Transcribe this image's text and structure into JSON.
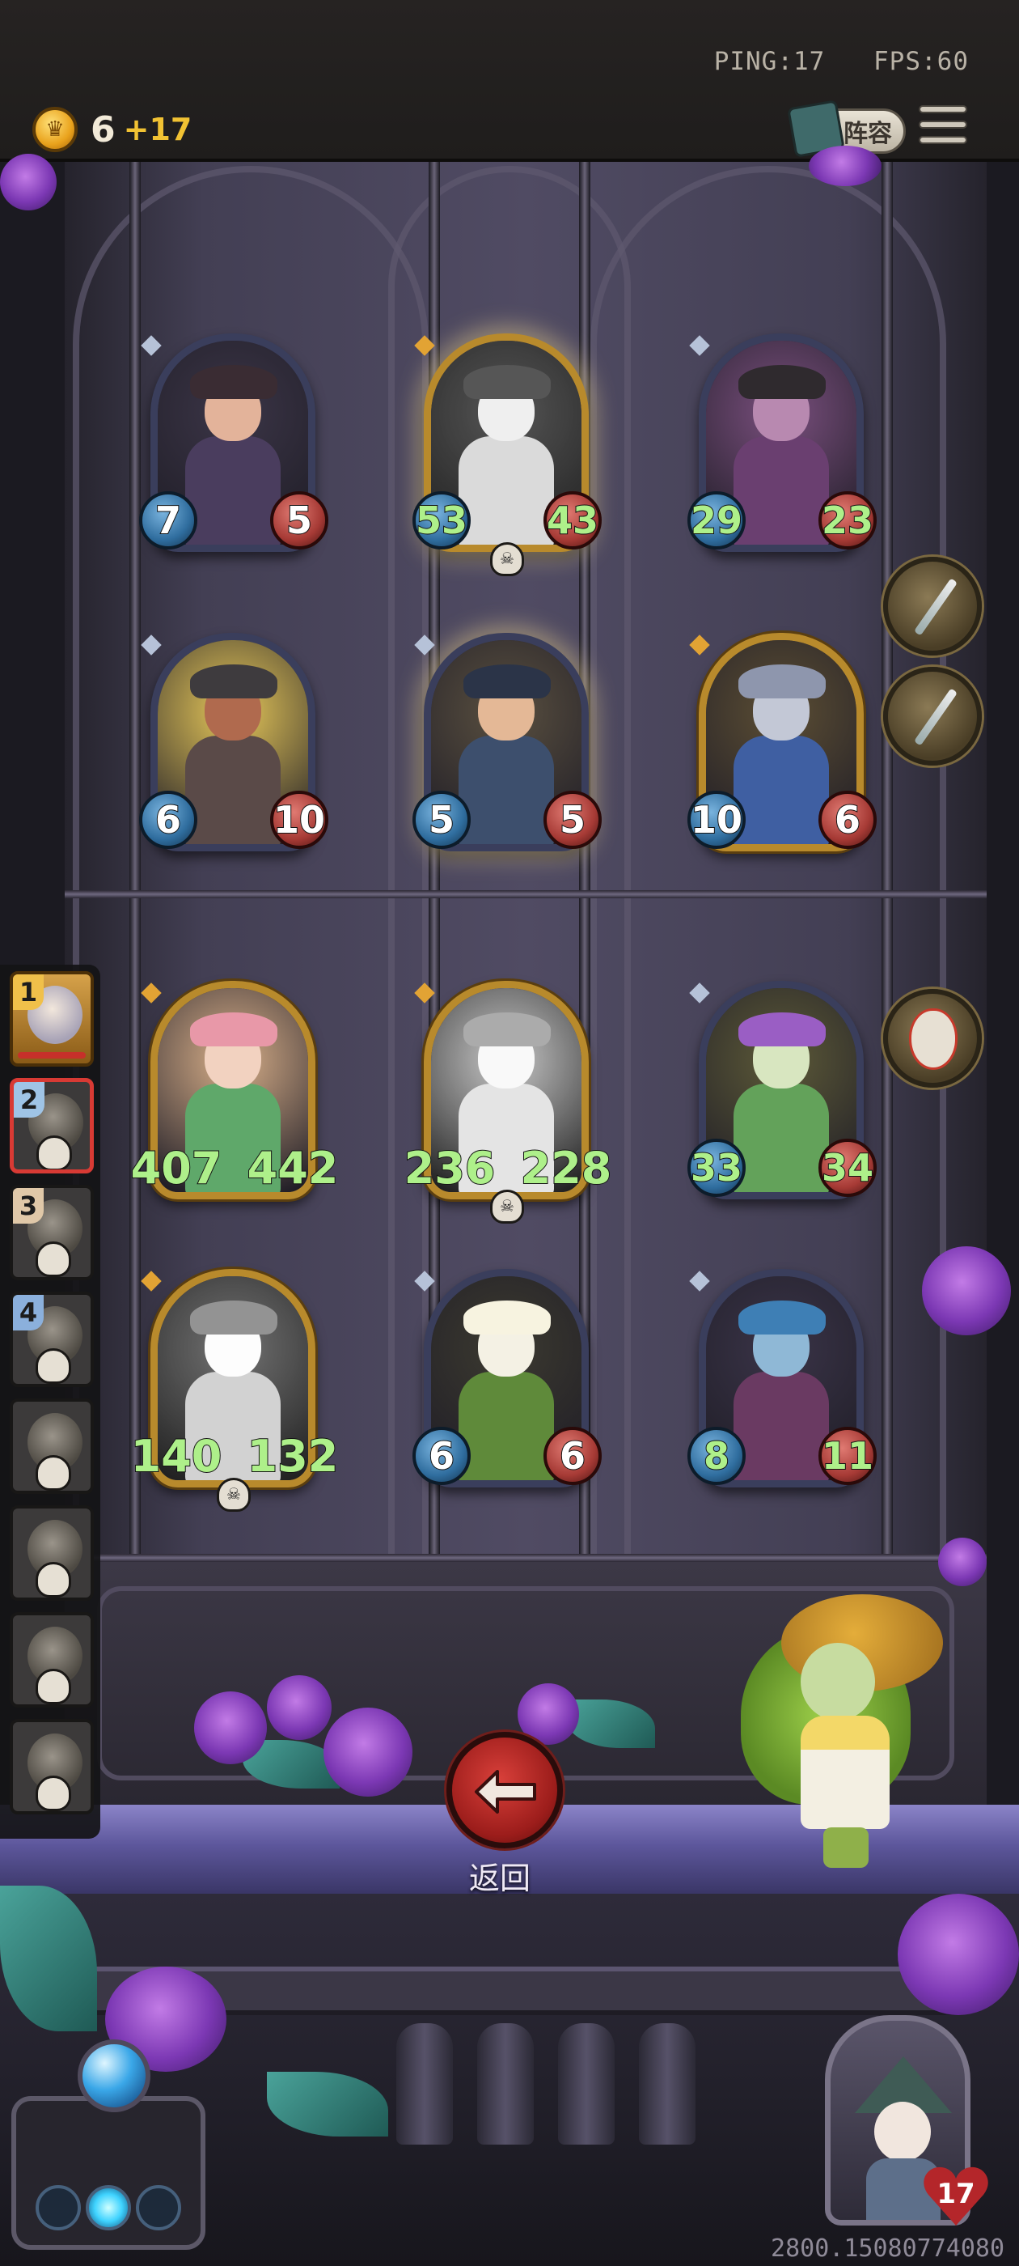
{
  "top_bar": {
    "ping_label": "PING:17",
    "fps_label": "FPS:60",
    "gold_count": "6",
    "gold_income": "+17",
    "lineup_button_label": "阵容"
  },
  "board": {
    "cards": [
      {
        "row": 1,
        "col": 1,
        "attack": "7",
        "health": "5",
        "frame": "blue",
        "dead": false,
        "buffed": false,
        "palette": {
          "bg": "#3b3547",
          "head": "#e3b39a",
          "body": "#4a3d5e",
          "hat": "#3a2c33"
        }
      },
      {
        "row": 1,
        "col": 2,
        "attack": "53",
        "health": "43",
        "frame": "gold",
        "dead": true,
        "buffed": true,
        "palette": {
          "bg": "#5b4b3e",
          "head": "#e8d8b8",
          "body": "#d8c59a",
          "hat": "#8c3f2f"
        }
      },
      {
        "row": 1,
        "col": 3,
        "attack": "29",
        "health": "23",
        "frame": "blue",
        "dead": false,
        "buffed": true,
        "palette": {
          "bg": "#7a4f7e",
          "head": "#b889b0",
          "body": "#6a3f70",
          "hat": "#2f2a2e"
        }
      },
      {
        "row": 2,
        "col": 1,
        "attack": "6",
        "health": "10",
        "frame": "blue",
        "dead": false,
        "buffed": false,
        "palette": {
          "bg": "#e8c95a",
          "head": "#b06a4e",
          "body": "#5a4a48",
          "hat": "#3e3b3e"
        }
      },
      {
        "row": 2,
        "col": 2,
        "attack": "5",
        "health": "5",
        "frame": "blue",
        "dead": false,
        "buffed": false,
        "palette": {
          "bg": "#5a5040",
          "head": "#e4b896",
          "body": "#3d4f6d",
          "hat": "#2b3448"
        }
      },
      {
        "row": 2,
        "col": 3,
        "attack": "10",
        "health": "6",
        "frame": "gold",
        "dead": false,
        "buffed": false,
        "palette": {
          "bg": "#5c4e34",
          "head": "#c3c8d6",
          "body": "#3f5fa2",
          "hat": "#8e96ad"
        }
      },
      {
        "row": 3,
        "col": 1,
        "attack": "407",
        "health": "442",
        "frame": "gold",
        "dead": false,
        "buffed": true,
        "palette": {
          "bg": "#d9b08a",
          "head": "#f2d2c0",
          "body": "#5fa86a",
          "hat": "#e898a8"
        }
      },
      {
        "row": 3,
        "col": 2,
        "attack": "236",
        "health": "228",
        "frame": "gold",
        "dead": true,
        "buffed": true,
        "palette": {
          "bg": "#b7b7b7",
          "head": "#e2e2e2",
          "body": "#cfcfcf",
          "hat": "#9b9b9b"
        }
      },
      {
        "row": 3,
        "col": 3,
        "attack": "33",
        "health": "34",
        "frame": "blue",
        "dead": false,
        "buffed": true,
        "palette": {
          "bg": "#5d5a38",
          "head": "#d8e6c0",
          "body": "#63a25a",
          "hat": "#9a5ec4"
        }
      },
      {
        "row": 4,
        "col": 1,
        "attack": "140",
        "health": "132",
        "frame": "gold",
        "dead": true,
        "buffed": true,
        "palette": {
          "bg": "#556a8e",
          "head": "#dfe7f5",
          "body": "#a9c1ec",
          "hat": "#6f86c8"
        }
      },
      {
        "row": 4,
        "col": 2,
        "attack": "6",
        "health": "6",
        "frame": "blue",
        "dead": false,
        "buffed": false,
        "palette": {
          "bg": "#3c3a30",
          "head": "#f4f1e4",
          "body": "#5f8a3a",
          "hat": "#f7f3e0"
        }
      },
      {
        "row": 4,
        "col": 3,
        "attack": "8",
        "health": "11",
        "frame": "blue",
        "dead": false,
        "buffed": true,
        "palette": {
          "bg": "#3a3448",
          "head": "#8fb8d6",
          "body": "#6a3a62",
          "hat": "#3e7fb5"
        }
      }
    ]
  },
  "side_items": [
    {
      "icon": "dagger-icon"
    },
    {
      "icon": "dagger-icon"
    },
    {
      "icon": "mask-icon"
    }
  ],
  "opponents": [
    {
      "rank": "1",
      "state": "alive"
    },
    {
      "rank": "2",
      "state": "selected"
    },
    {
      "rank": "3",
      "state": "dead"
    },
    {
      "rank": "4",
      "state": "dead"
    },
    {
      "rank": "",
      "state": "dead"
    },
    {
      "rank": "",
      "state": "dead"
    },
    {
      "rank": "",
      "state": "dead"
    },
    {
      "rank": "",
      "state": "dead"
    }
  ],
  "return_button": {
    "label": "返回",
    "icon": "arrow-left-icon"
  },
  "player": {
    "health": "17",
    "icon": "heart-icon"
  },
  "build_id": "2800.15080774080",
  "colors": {
    "buff_green": "#aef08a",
    "gold_text": "#f1c233",
    "accent_red": "#d83a34"
  }
}
